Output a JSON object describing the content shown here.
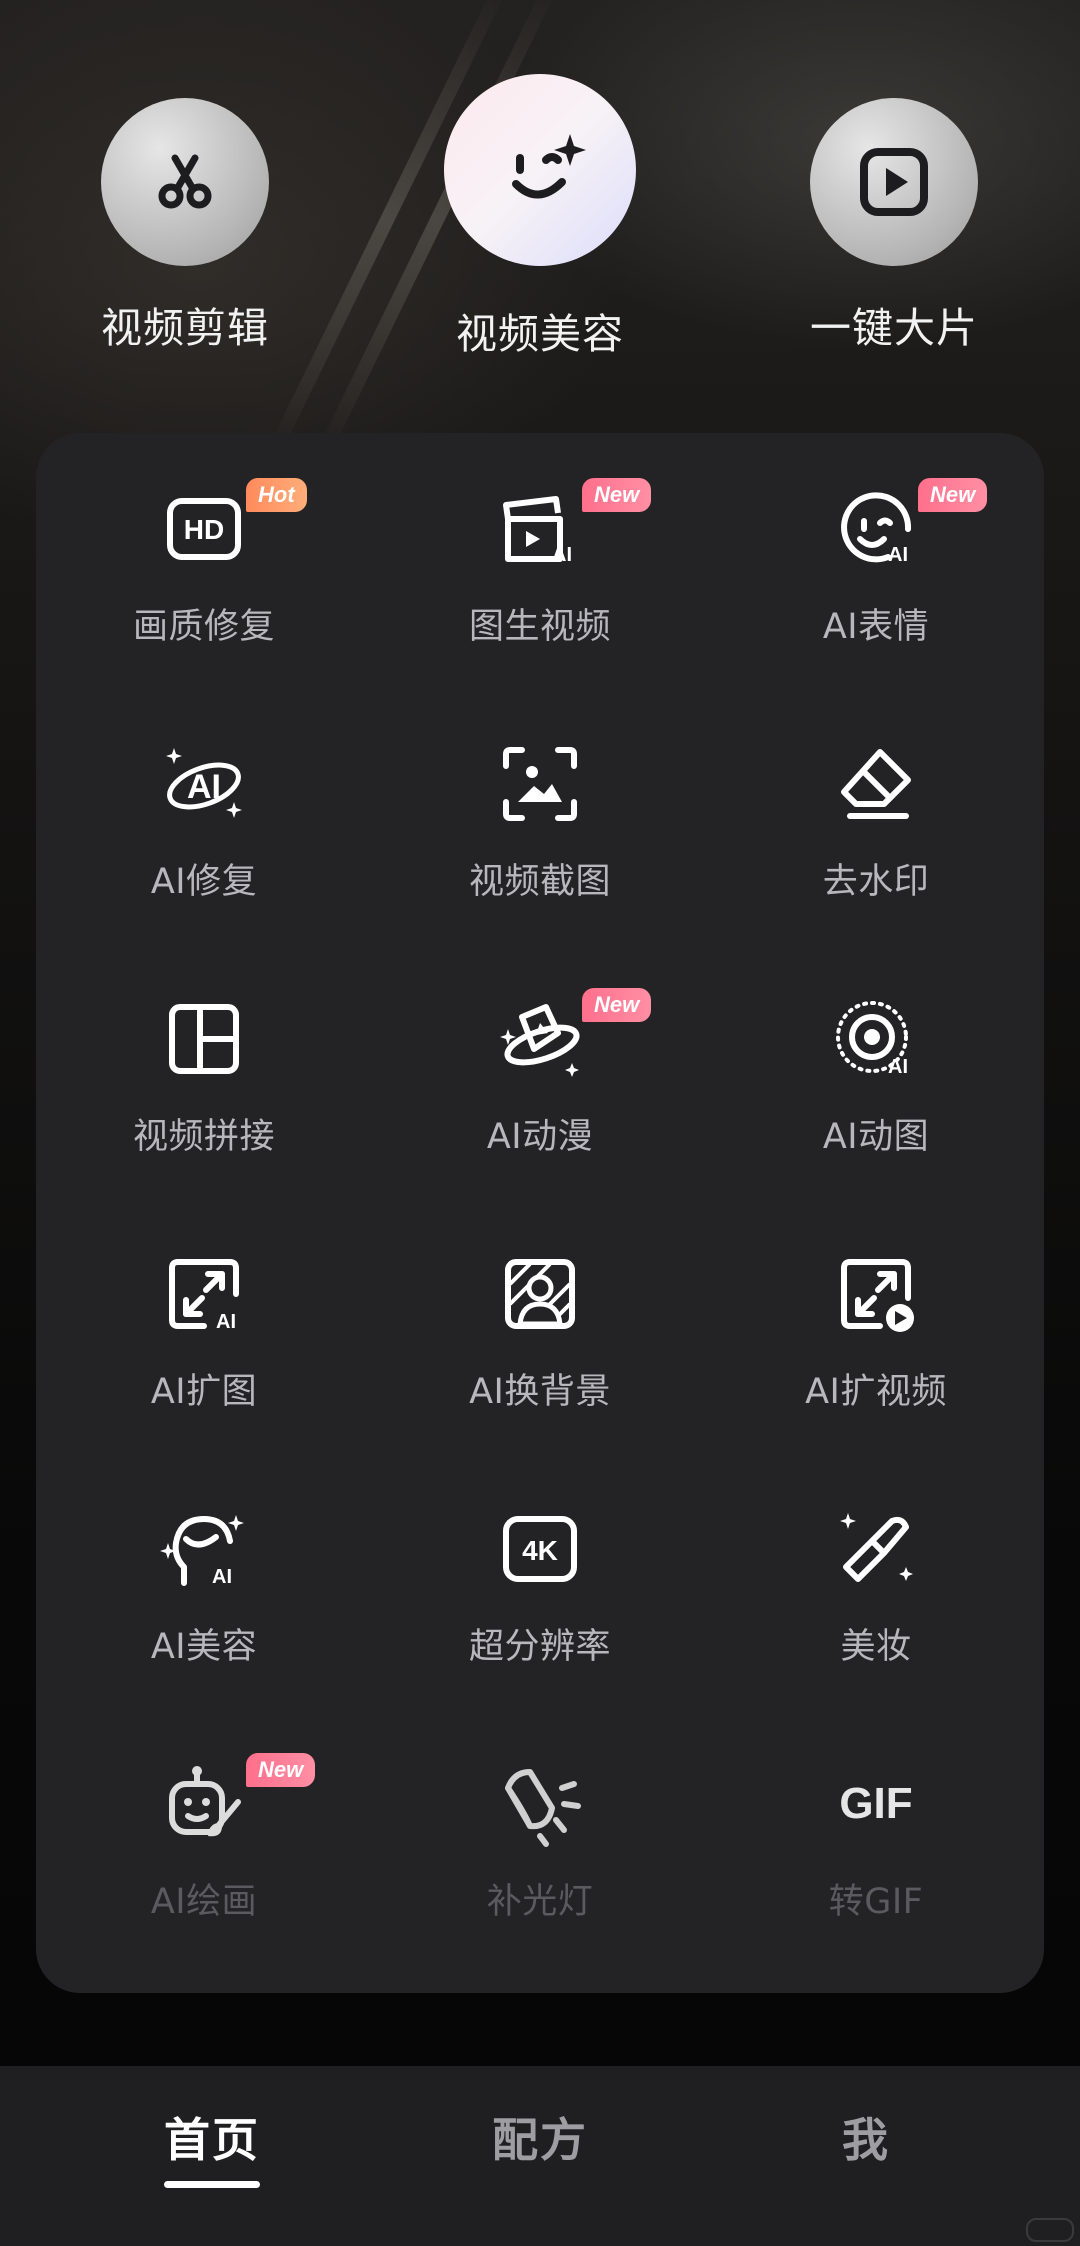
{
  "top_actions": [
    {
      "label": "视频剪辑",
      "icon": "scissors-icon"
    },
    {
      "label": "视频美容",
      "icon": "smile-sparkle-icon"
    },
    {
      "label": "一键大片",
      "icon": "play-square-icon"
    }
  ],
  "tools": [
    {
      "label": "画质修复",
      "icon": "hd-icon",
      "badge": "Hot"
    },
    {
      "label": "图生视频",
      "icon": "clapper-ai-icon",
      "badge": "New"
    },
    {
      "label": "AI表情",
      "icon": "ai-face-icon",
      "badge": "New"
    },
    {
      "label": "AI修复",
      "icon": "ai-sparkle-icon",
      "badge": ""
    },
    {
      "label": "视频截图",
      "icon": "screenshot-icon",
      "badge": ""
    },
    {
      "label": "去水印",
      "icon": "eraser-icon",
      "badge": ""
    },
    {
      "label": "视频拼接",
      "icon": "grid-layout-icon",
      "badge": ""
    },
    {
      "label": "AI动漫",
      "icon": "planet-icon",
      "badge": "New"
    },
    {
      "label": "AI动图",
      "icon": "ai-gif-circle-icon",
      "badge": ""
    },
    {
      "label": "AI扩图",
      "icon": "expand-ai-icon",
      "badge": ""
    },
    {
      "label": "AI换背景",
      "icon": "portrait-bg-icon",
      "badge": ""
    },
    {
      "label": "AI扩视频",
      "icon": "expand-video-icon",
      "badge": ""
    },
    {
      "label": "AI美容",
      "icon": "ai-beauty-icon",
      "badge": ""
    },
    {
      "label": "超分辨率",
      "icon": "4k-icon",
      "badge": ""
    },
    {
      "label": "美妆",
      "icon": "lipstick-icon",
      "badge": ""
    },
    {
      "label": "AI绘画",
      "icon": "robot-brush-icon",
      "badge": "New"
    },
    {
      "label": "补光灯",
      "icon": "fill-light-icon",
      "badge": ""
    },
    {
      "label": "转GIF",
      "icon": "gif-icon",
      "badge": ""
    }
  ],
  "tools_icon_text": {
    "hd": "HD",
    "ai": "AI",
    "k4": "4K",
    "gif": "GIF"
  },
  "tabbar": {
    "home": "首页",
    "recipe": "配方",
    "me": "我",
    "active": "首页"
  }
}
